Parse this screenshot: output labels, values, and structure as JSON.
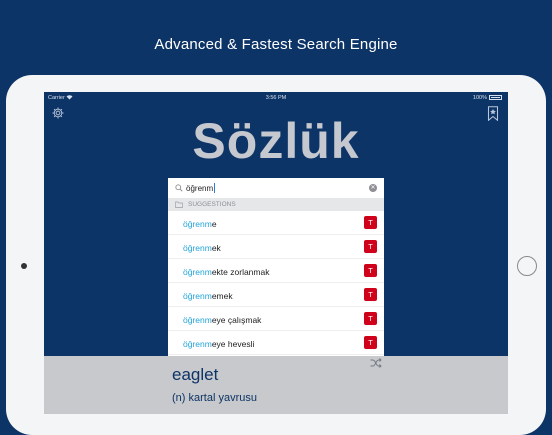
{
  "headline": "Advanced & Fastest Search Engine",
  "status": {
    "carrier": "Carrier",
    "time": "3:56 PM",
    "battery": "100%"
  },
  "app": {
    "logo": "Sözlük"
  },
  "search": {
    "query": "öğrenm",
    "icon": "search-icon",
    "clear_icon": "clear-icon"
  },
  "suggestions": {
    "header": "SUGGESTIONS",
    "badge": "T",
    "items": [
      {
        "match": "öğrenm",
        "rest": "e"
      },
      {
        "match": "öğrenm",
        "rest": "ek"
      },
      {
        "match": "öğrenm",
        "rest": "ekte zorlanmak"
      },
      {
        "match": "öğrenm",
        "rest": "emek"
      },
      {
        "match": "öğrenm",
        "rest": "eye çalışmak"
      },
      {
        "match": "öğrenm",
        "rest": "eye hevesli"
      }
    ]
  },
  "result": {
    "word": "eaglet",
    "definition": "(n)  kartal yavrusu"
  },
  "colors": {
    "brand": "#0d3466",
    "highlight": "#22a3d9",
    "badge": "#d0021b"
  }
}
